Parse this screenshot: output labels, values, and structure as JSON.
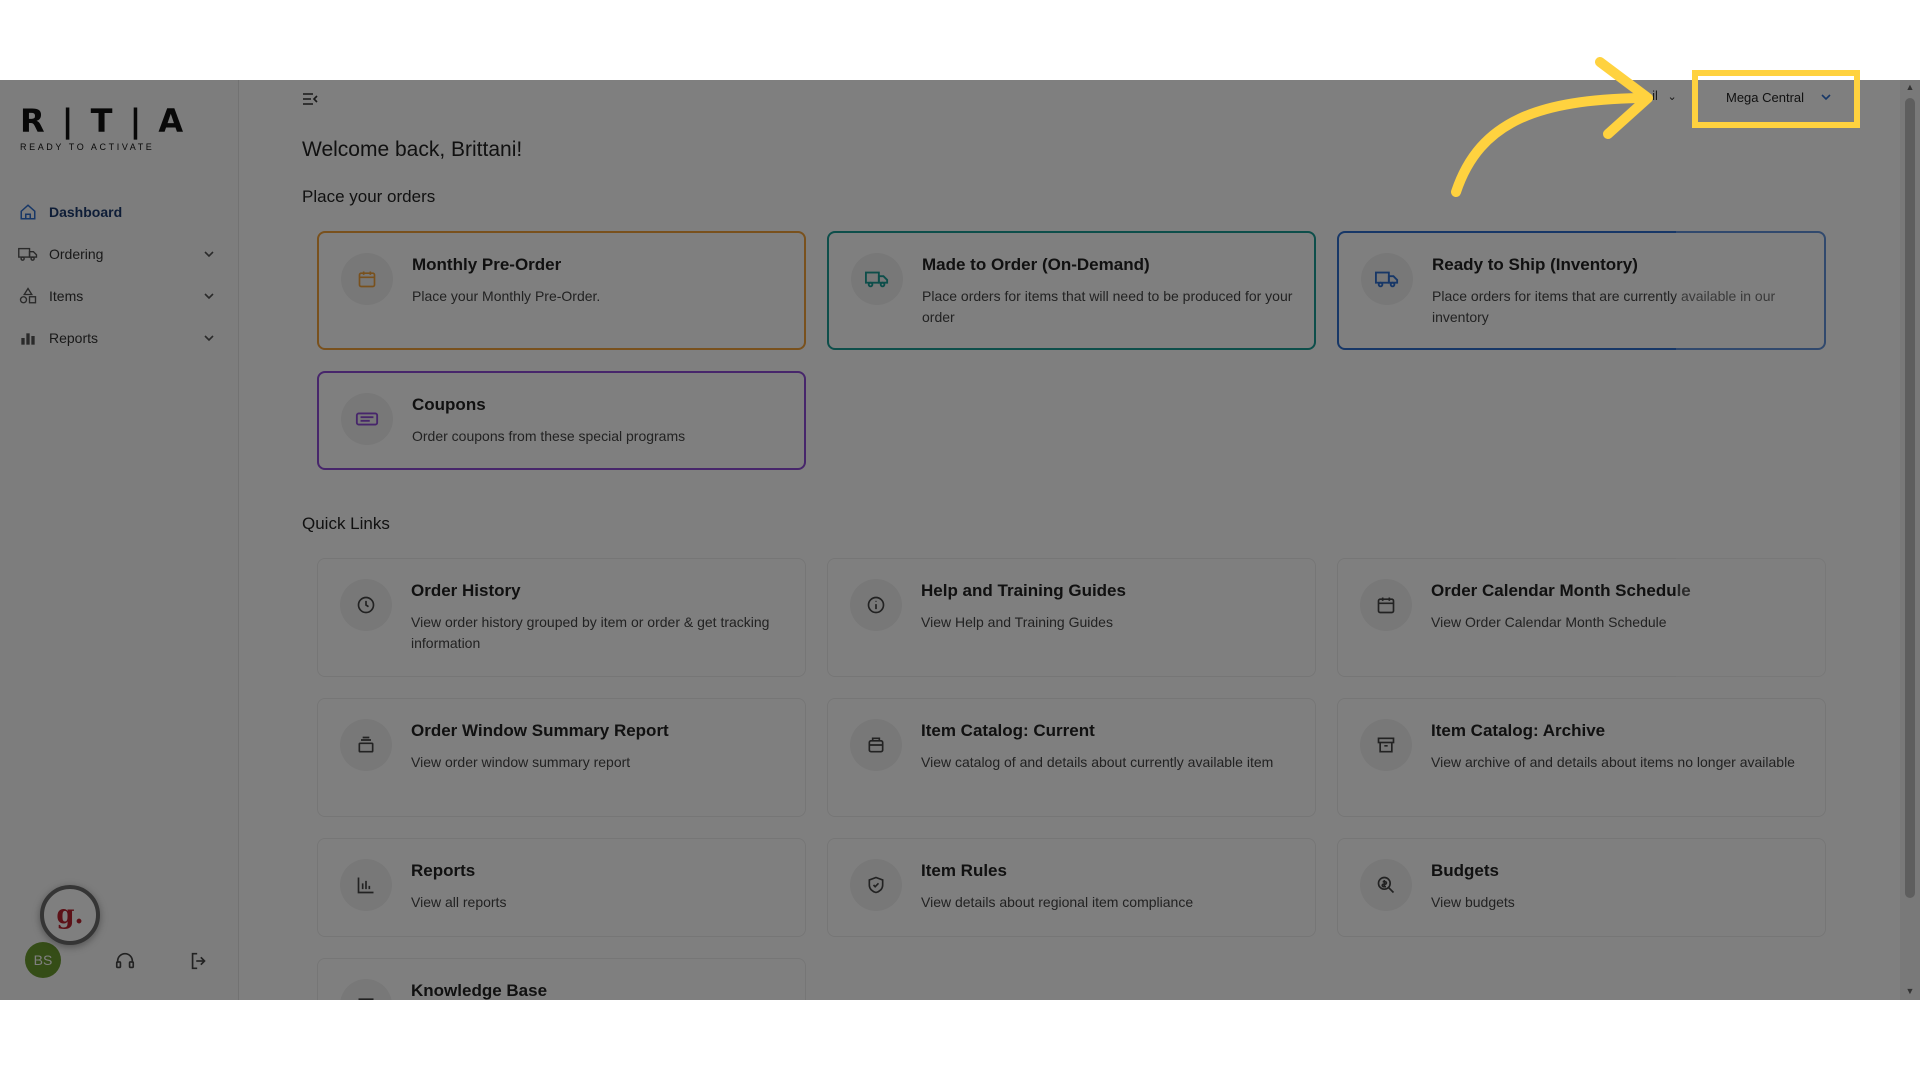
{
  "logo": {
    "text": "R | T | A",
    "tagline": "READY TO ACTIVATE"
  },
  "sidebar": {
    "items": [
      {
        "label": "Dashboard",
        "icon": "home-icon",
        "active": true
      },
      {
        "label": "Ordering",
        "icon": "truck-icon",
        "expandable": true
      },
      {
        "label": "Items",
        "icon": "shapes-icon",
        "expandable": true
      },
      {
        "label": "Reports",
        "icon": "bar-chart-icon",
        "expandable": true
      }
    ],
    "footer": {
      "avatar_initials": "BS",
      "badge_text": "g."
    }
  },
  "header": {
    "retail_label": "etail",
    "store_selector": "Mega Central"
  },
  "main": {
    "welcome": "Welcome back, Brittani!",
    "orders_title": "Place your orders",
    "order_cards": [
      {
        "title": "Monthly Pre-Order",
        "desc": "Place your Monthly Pre-Order.",
        "accent": "#f3a23a"
      },
      {
        "title": "Made to Order (On-Demand)",
        "desc": "Place orders for items that will need to be produced for your order",
        "accent": "#1a9c95"
      },
      {
        "title": "Ready to Ship (Inventory)",
        "desc": "Place orders for items that are currently available in our inventory",
        "accent": "#2f6fcf"
      },
      {
        "title": "Coupons",
        "desc": "Order coupons from these special programs",
        "accent": "#8f4dd6"
      }
    ],
    "quick_links_title": "Quick Links",
    "quick_links": [
      {
        "title": "Order History",
        "desc": "View order history grouped by item or order & get tracking information",
        "icon": "clock-icon"
      },
      {
        "title": "Help and Training Guides",
        "desc": "View Help and Training Guides",
        "icon": "info-icon"
      },
      {
        "title": "Order Calendar Month Schedule",
        "desc": "View Order Calendar Month Schedule",
        "icon": "calendar-icon"
      },
      {
        "title": "Order Window Summary Report",
        "desc": "View order window summary report",
        "icon": "stack-icon"
      },
      {
        "title": "Item Catalog: Current",
        "desc": "View catalog of and details about currently available item",
        "icon": "package-icon"
      },
      {
        "title": "Item Catalog: Archive",
        "desc": "View archive of and details about items no longer available",
        "icon": "archive-icon"
      },
      {
        "title": "Reports",
        "desc": "View all reports",
        "icon": "chart-icon"
      },
      {
        "title": "Item Rules",
        "desc": "View details about regional item compliance",
        "icon": "shield-check-icon"
      },
      {
        "title": "Budgets",
        "desc": "View budgets",
        "icon": "search-money-icon"
      },
      {
        "title": "Knowledge Base",
        "desc": "",
        "icon": "book-icon"
      }
    ]
  },
  "colors": {
    "highlight": "#ffd23f",
    "overlay": "rgba(0,0,0,0.5)",
    "active_nav": "#1d3b6e"
  }
}
